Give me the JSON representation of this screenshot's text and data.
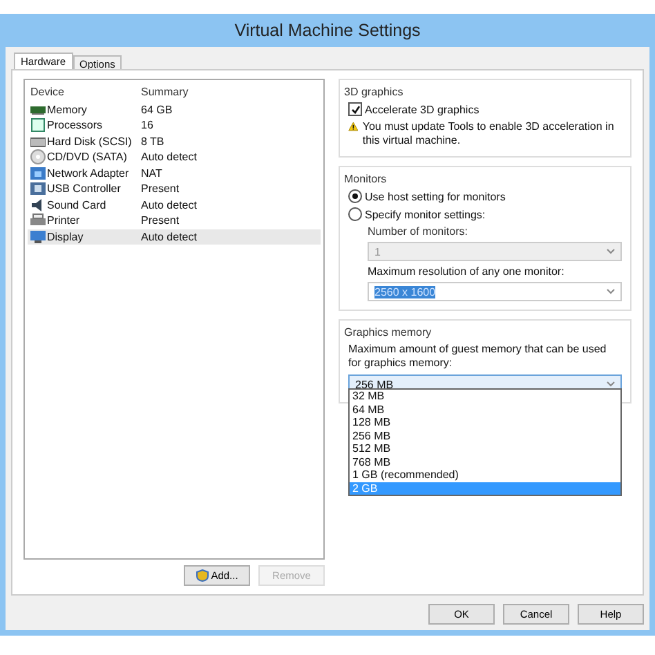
{
  "window": {
    "title": "Virtual Machine Settings"
  },
  "tabs": [
    {
      "label": "Hardware",
      "selected": true
    },
    {
      "label": "Options",
      "selected": false
    }
  ],
  "device_table": {
    "columns": [
      "Device",
      "Summary"
    ],
    "rows": [
      {
        "kind": "memory",
        "device": "Memory",
        "summary": "64 GB",
        "selected": false
      },
      {
        "kind": "processor",
        "device": "Processors",
        "summary": "16",
        "selected": false
      },
      {
        "kind": "disk",
        "device": "Hard Disk (SCSI)",
        "summary": "8 TB",
        "selected": false
      },
      {
        "kind": "cd",
        "device": "CD/DVD (SATA)",
        "summary": "Auto detect",
        "selected": false
      },
      {
        "kind": "network",
        "device": "Network Adapter",
        "summary": "NAT",
        "selected": false
      },
      {
        "kind": "usb",
        "device": "USB Controller",
        "summary": "Present",
        "selected": false
      },
      {
        "kind": "sound",
        "device": "Sound Card",
        "summary": "Auto detect",
        "selected": false
      },
      {
        "kind": "printer",
        "device": "Printer",
        "summary": "Present",
        "selected": false
      },
      {
        "kind": "display",
        "device": "Display",
        "summary": "Auto detect",
        "selected": true
      }
    ]
  },
  "device_buttons": [
    {
      "label": "Add...",
      "disabled": false
    },
    {
      "label": "Remove",
      "disabled": true
    }
  ],
  "graphics_3d": {
    "title": "3D graphics",
    "accelerate": {
      "label": "Accelerate 3D graphics",
      "checked": true
    },
    "warning": "You must update Tools to enable 3D acceleration in this virtual machine."
  },
  "monitors": {
    "title": "Monitors",
    "options": [
      {
        "label": "Use host setting for monitors",
        "selected": true
      },
      {
        "label": "Specify monitor settings:",
        "selected": false
      }
    ],
    "number_label": "Number of monitors:",
    "number_value": "1",
    "number_disabled": true,
    "resolution_label": "Maximum resolution of any one monitor:",
    "resolution_value": "2560 x 1600"
  },
  "graphics_memory": {
    "title": "Graphics memory",
    "description": "Maximum amount of guest memory that can be used for graphics memory:",
    "value": "256 MB",
    "options": [
      {
        "label": "32 MB",
        "highlighted": false
      },
      {
        "label": "64 MB",
        "highlighted": false
      },
      {
        "label": "128 MB",
        "highlighted": false
      },
      {
        "label": "256 MB",
        "highlighted": false
      },
      {
        "label": "512 MB",
        "highlighted": false
      },
      {
        "label": "768 MB",
        "highlighted": false
      },
      {
        "label": "1 GB (recommended)",
        "highlighted": false
      },
      {
        "label": "2 GB",
        "highlighted": true
      }
    ]
  },
  "dialog_buttons": [
    "OK",
    "Cancel",
    "Help"
  ]
}
